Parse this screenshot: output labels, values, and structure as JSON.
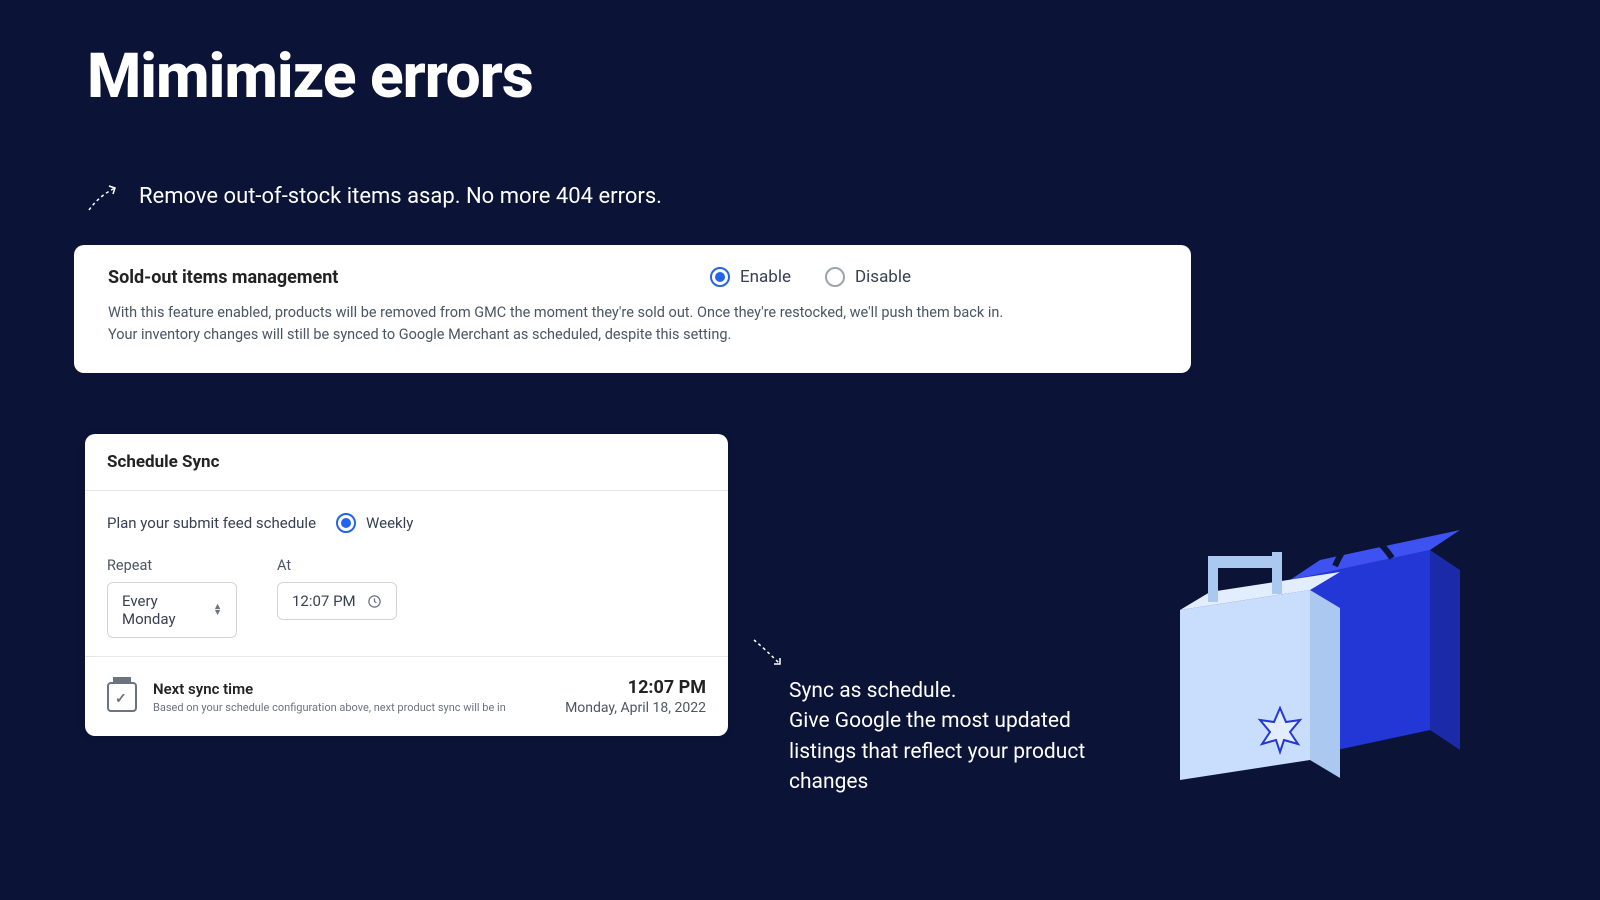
{
  "heading": "Mimimize errors",
  "caption1": "Remove out-of-stock items asap. No more 404 errors.",
  "card1": {
    "title": "Sold-out items management",
    "enable_label": "Enable",
    "disable_label": "Disable",
    "desc1": "With this feature enabled, products will be removed from GMC the moment they're sold out. Once they're restocked, we'll push them back in.",
    "desc2": "Your inventory changes will still be synced to Google Merchant as scheduled, despite this setting."
  },
  "card2": {
    "title": "Schedule Sync",
    "plan_label": "Plan your submit feed schedule",
    "frequency_label": "Weekly",
    "repeat_label": "Repeat",
    "repeat_value": "Every Monday",
    "at_label": "At",
    "at_value": "12:07 PM",
    "next_title": "Next sync time",
    "next_sub": "Based on your schedule configuration above, next product sync will be in",
    "next_time": "12:07 PM",
    "next_date": "Monday, April 18, 2022"
  },
  "caption2_line1": "Sync as schedule.",
  "caption2_line2": "Give Google the most updated listings that reflect your product changes"
}
